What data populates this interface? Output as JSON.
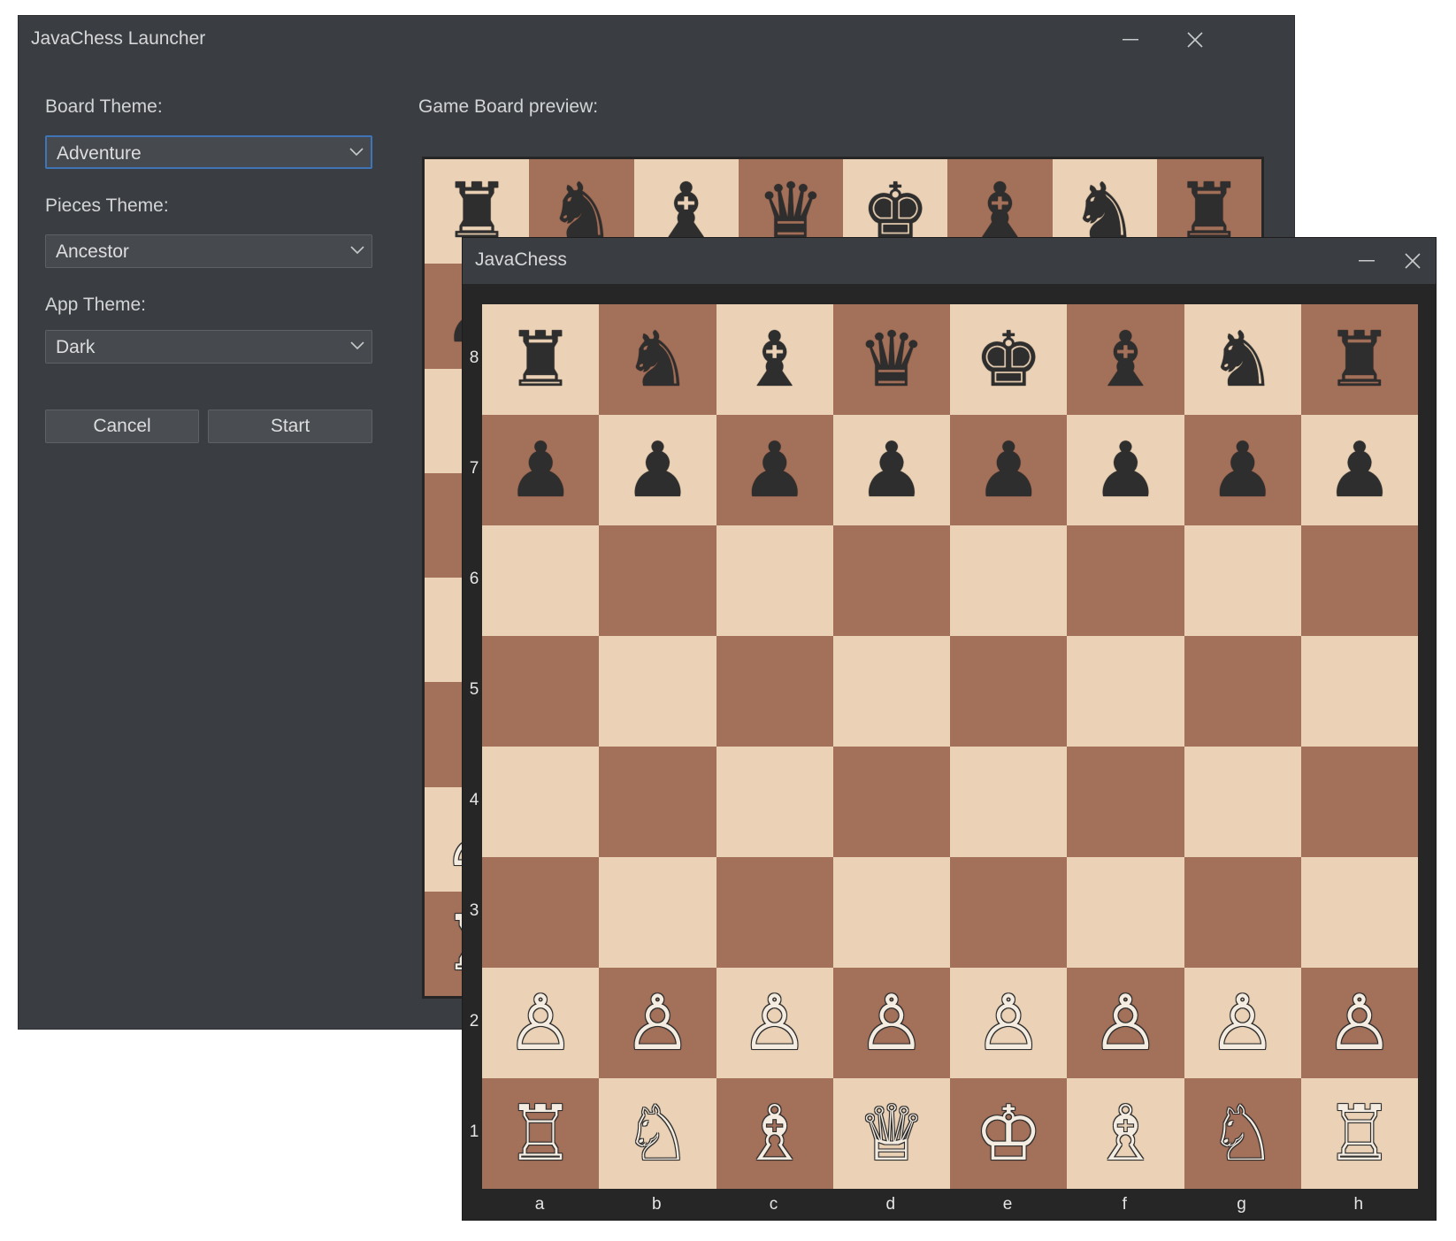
{
  "launcher": {
    "title": "JavaChess Launcher",
    "board_theme_label": "Board Theme:",
    "board_theme_value": "Adventure",
    "pieces_theme_label": "Pieces Theme:",
    "pieces_theme_value": "Ancestor",
    "app_theme_label": "App Theme:",
    "app_theme_value": "Dark",
    "cancel_label": "Cancel",
    "start_label": "Start",
    "preview_label": "Game Board preview:"
  },
  "game": {
    "title": "JavaChess",
    "ranks": [
      "8",
      "7",
      "6",
      "5",
      "4",
      "3",
      "2",
      "1"
    ],
    "files": [
      "a",
      "b",
      "c",
      "d",
      "e",
      "f",
      "g",
      "h"
    ],
    "position": [
      [
        "♜",
        "♞",
        "♝",
        "♛",
        "♚",
        "♝",
        "♞",
        "♜"
      ],
      [
        "♟",
        "♟",
        "♟",
        "♟",
        "♟",
        "♟",
        "♟",
        "♟"
      ],
      [
        "",
        "",
        "",
        "",
        "",
        "",
        "",
        ""
      ],
      [
        "",
        "",
        "",
        "",
        "",
        "",
        "",
        ""
      ],
      [
        "",
        "",
        "",
        "",
        "",
        "",
        "",
        ""
      ],
      [
        "",
        "",
        "",
        "",
        "",
        "",
        "",
        ""
      ],
      [
        "♙",
        "♙",
        "♙",
        "♙",
        "♙",
        "♙",
        "♙",
        "♙"
      ],
      [
        "♖",
        "♘",
        "♗",
        "♕",
        "♔",
        "♗",
        "♘",
        "♖"
      ]
    ]
  },
  "colors": {
    "light_square": "#ebd2b6",
    "dark_square": "#a3705a",
    "window_bg": "#3a3d41",
    "focus_border": "#3d75b8"
  }
}
